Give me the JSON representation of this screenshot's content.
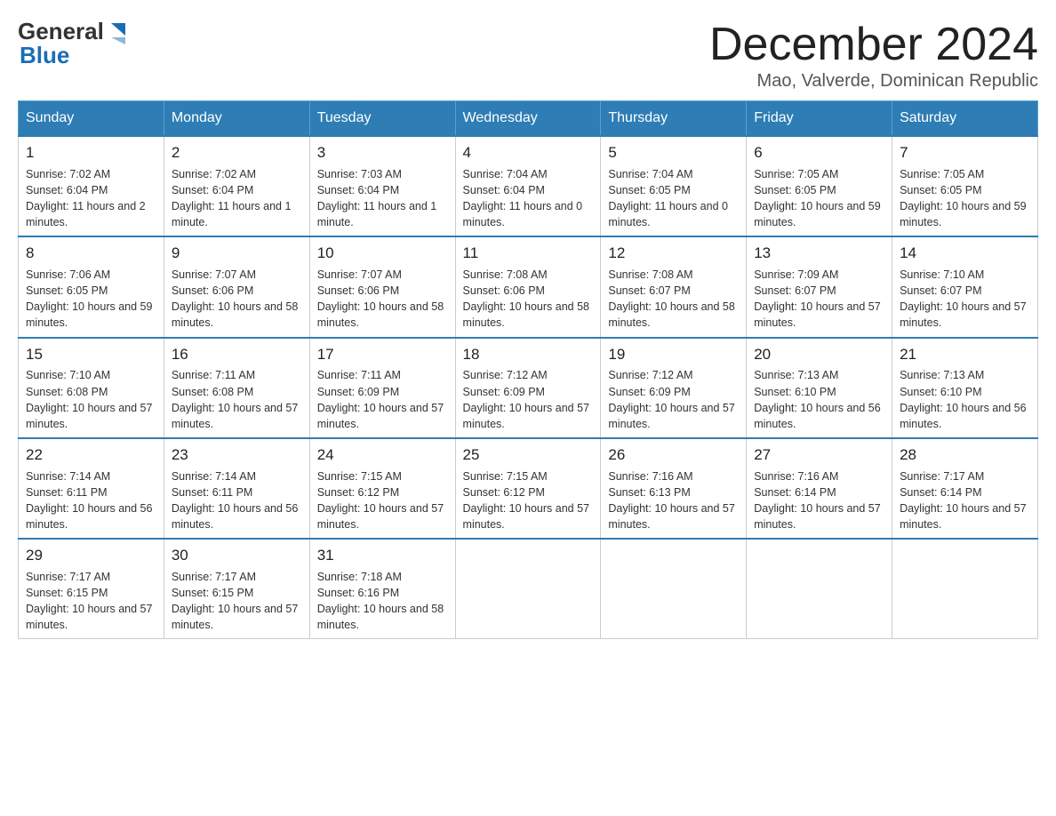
{
  "header": {
    "logo": {
      "general": "General",
      "blue": "Blue",
      "arrow": "▶"
    },
    "title": "December 2024",
    "subtitle": "Mao, Valverde, Dominican Republic"
  },
  "days_of_week": [
    "Sunday",
    "Monday",
    "Tuesday",
    "Wednesday",
    "Thursday",
    "Friday",
    "Saturday"
  ],
  "weeks": [
    [
      {
        "day": "1",
        "sunrise": "7:02 AM",
        "sunset": "6:04 PM",
        "daylight": "11 hours and 2 minutes."
      },
      {
        "day": "2",
        "sunrise": "7:02 AM",
        "sunset": "6:04 PM",
        "daylight": "11 hours and 1 minute."
      },
      {
        "day": "3",
        "sunrise": "7:03 AM",
        "sunset": "6:04 PM",
        "daylight": "11 hours and 1 minute."
      },
      {
        "day": "4",
        "sunrise": "7:04 AM",
        "sunset": "6:04 PM",
        "daylight": "11 hours and 0 minutes."
      },
      {
        "day": "5",
        "sunrise": "7:04 AM",
        "sunset": "6:05 PM",
        "daylight": "11 hours and 0 minutes."
      },
      {
        "day": "6",
        "sunrise": "7:05 AM",
        "sunset": "6:05 PM",
        "daylight": "10 hours and 59 minutes."
      },
      {
        "day": "7",
        "sunrise": "7:05 AM",
        "sunset": "6:05 PM",
        "daylight": "10 hours and 59 minutes."
      }
    ],
    [
      {
        "day": "8",
        "sunrise": "7:06 AM",
        "sunset": "6:05 PM",
        "daylight": "10 hours and 59 minutes."
      },
      {
        "day": "9",
        "sunrise": "7:07 AM",
        "sunset": "6:06 PM",
        "daylight": "10 hours and 58 minutes."
      },
      {
        "day": "10",
        "sunrise": "7:07 AM",
        "sunset": "6:06 PM",
        "daylight": "10 hours and 58 minutes."
      },
      {
        "day": "11",
        "sunrise": "7:08 AM",
        "sunset": "6:06 PM",
        "daylight": "10 hours and 58 minutes."
      },
      {
        "day": "12",
        "sunrise": "7:08 AM",
        "sunset": "6:07 PM",
        "daylight": "10 hours and 58 minutes."
      },
      {
        "day": "13",
        "sunrise": "7:09 AM",
        "sunset": "6:07 PM",
        "daylight": "10 hours and 57 minutes."
      },
      {
        "day": "14",
        "sunrise": "7:10 AM",
        "sunset": "6:07 PM",
        "daylight": "10 hours and 57 minutes."
      }
    ],
    [
      {
        "day": "15",
        "sunrise": "7:10 AM",
        "sunset": "6:08 PM",
        "daylight": "10 hours and 57 minutes."
      },
      {
        "day": "16",
        "sunrise": "7:11 AM",
        "sunset": "6:08 PM",
        "daylight": "10 hours and 57 minutes."
      },
      {
        "day": "17",
        "sunrise": "7:11 AM",
        "sunset": "6:09 PM",
        "daylight": "10 hours and 57 minutes."
      },
      {
        "day": "18",
        "sunrise": "7:12 AM",
        "sunset": "6:09 PM",
        "daylight": "10 hours and 57 minutes."
      },
      {
        "day": "19",
        "sunrise": "7:12 AM",
        "sunset": "6:09 PM",
        "daylight": "10 hours and 57 minutes."
      },
      {
        "day": "20",
        "sunrise": "7:13 AM",
        "sunset": "6:10 PM",
        "daylight": "10 hours and 56 minutes."
      },
      {
        "day": "21",
        "sunrise": "7:13 AM",
        "sunset": "6:10 PM",
        "daylight": "10 hours and 56 minutes."
      }
    ],
    [
      {
        "day": "22",
        "sunrise": "7:14 AM",
        "sunset": "6:11 PM",
        "daylight": "10 hours and 56 minutes."
      },
      {
        "day": "23",
        "sunrise": "7:14 AM",
        "sunset": "6:11 PM",
        "daylight": "10 hours and 56 minutes."
      },
      {
        "day": "24",
        "sunrise": "7:15 AM",
        "sunset": "6:12 PM",
        "daylight": "10 hours and 57 minutes."
      },
      {
        "day": "25",
        "sunrise": "7:15 AM",
        "sunset": "6:12 PM",
        "daylight": "10 hours and 57 minutes."
      },
      {
        "day": "26",
        "sunrise": "7:16 AM",
        "sunset": "6:13 PM",
        "daylight": "10 hours and 57 minutes."
      },
      {
        "day": "27",
        "sunrise": "7:16 AM",
        "sunset": "6:14 PM",
        "daylight": "10 hours and 57 minutes."
      },
      {
        "day": "28",
        "sunrise": "7:17 AM",
        "sunset": "6:14 PM",
        "daylight": "10 hours and 57 minutes."
      }
    ],
    [
      {
        "day": "29",
        "sunrise": "7:17 AM",
        "sunset": "6:15 PM",
        "daylight": "10 hours and 57 minutes."
      },
      {
        "day": "30",
        "sunrise": "7:17 AM",
        "sunset": "6:15 PM",
        "daylight": "10 hours and 57 minutes."
      },
      {
        "day": "31",
        "sunrise": "7:18 AM",
        "sunset": "6:16 PM",
        "daylight": "10 hours and 58 minutes."
      },
      null,
      null,
      null,
      null
    ]
  ]
}
